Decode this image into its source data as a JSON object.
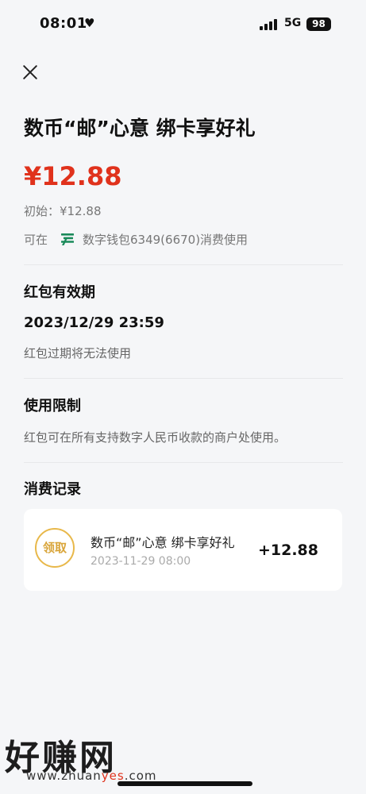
{
  "status_bar": {
    "time": "08:01",
    "heart": "♥",
    "network": "5G",
    "battery": "98"
  },
  "header": {
    "close_icon": "close-icon"
  },
  "packet": {
    "title": "数币“邮”心意 绑卡享好礼",
    "amount": "¥12.88",
    "initial": "初始：¥12.88",
    "usage_prefix": "可在",
    "usage_wallet": "数字钱包6349(6670)消费使用"
  },
  "validity": {
    "title": "红包有效期",
    "expiry": "2023/12/29 23:59",
    "note": "红包过期将无法使用"
  },
  "restriction": {
    "title": "使用限制",
    "note": "红包可在所有支持数字人民币收款的商户处使用。"
  },
  "records": {
    "title": "消费记录",
    "items": [
      {
        "badge": "领取",
        "name": "数币“邮”心意 绑卡享好礼",
        "time": "2023-11-29 08:00",
        "amount": "+12.88"
      }
    ]
  },
  "watermark": {
    "brand": "好赚网",
    "url_prefix": "www.zhuan",
    "url_highlight": "yes",
    "url_suffix": ".com"
  },
  "colors": {
    "amount_red": "#e0321c",
    "badge_gold": "#d9a53a",
    "logo_green": "#1a8a5a"
  }
}
